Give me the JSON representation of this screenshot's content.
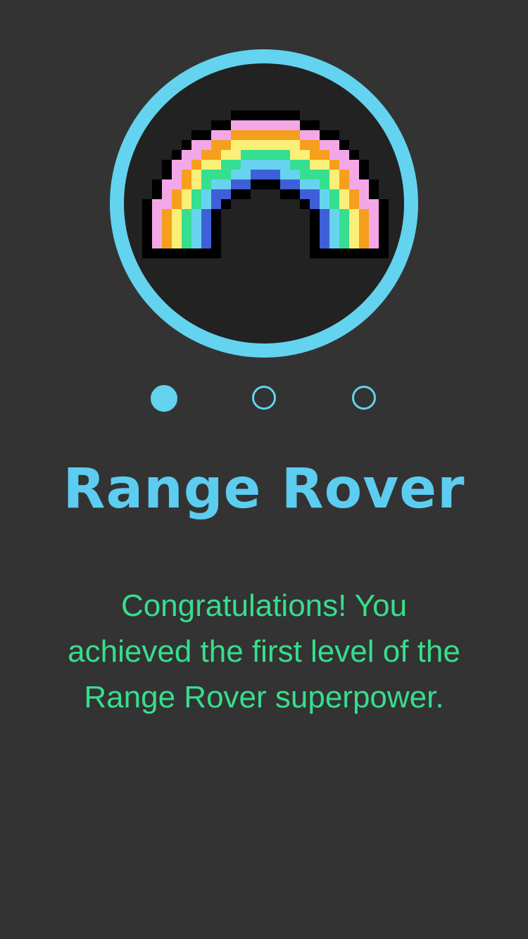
{
  "badge": {
    "name": "rainbow-badge",
    "ring_color": "#63d3ef"
  },
  "pager": {
    "count": 3,
    "active_index": 0
  },
  "title": "Range Rover",
  "message": "Congratulations! You achieved the first level of the Range Rover superpower.",
  "colors": {
    "title": "#5ccdf0",
    "message": "#37de8c",
    "background": "#333333"
  }
}
